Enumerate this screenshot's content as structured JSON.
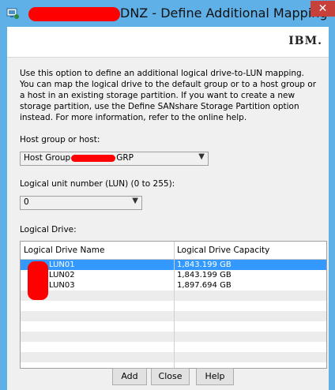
{
  "window": {
    "title": "DNZ - Define Additional Mapping"
  },
  "header": {
    "logo": "IBM."
  },
  "description": "Use this option to define an additional logical drive-to-LUN mapping. You can map the logical drive to the default group or to a host group or a host in an existing storage partition. If you want to create a new storage partition, use the Define SANshare Storage Partition option instead. For more information, refer to the online help.",
  "host": {
    "label": "Host group or host:",
    "value_prefix": "Host Group",
    "value_suffix": "GRP"
  },
  "lun": {
    "label": "Logical unit number (LUN) (0 to 255):",
    "value": "0"
  },
  "drives": {
    "label": "Logical Drive:",
    "columns": [
      "Logical Drive Name",
      "Logical Drive Capacity"
    ],
    "rows": [
      {
        "name": "LUN01",
        "capacity": "1,843.199 GB"
      },
      {
        "name": "LUN02",
        "capacity": "1,843.199 GB"
      },
      {
        "name": "LUN03",
        "capacity": "1,897.694 GB"
      }
    ]
  },
  "buttons": {
    "add": "Add",
    "close": "Close",
    "help": "Help"
  },
  "icons": {
    "app": "storage-manager-icon",
    "close": "close-icon",
    "dropdown": "chevron-down-icon"
  },
  "colors": {
    "titlebar": "#60b0e8",
    "selection": "#3399ff",
    "close": "#c7413a"
  }
}
